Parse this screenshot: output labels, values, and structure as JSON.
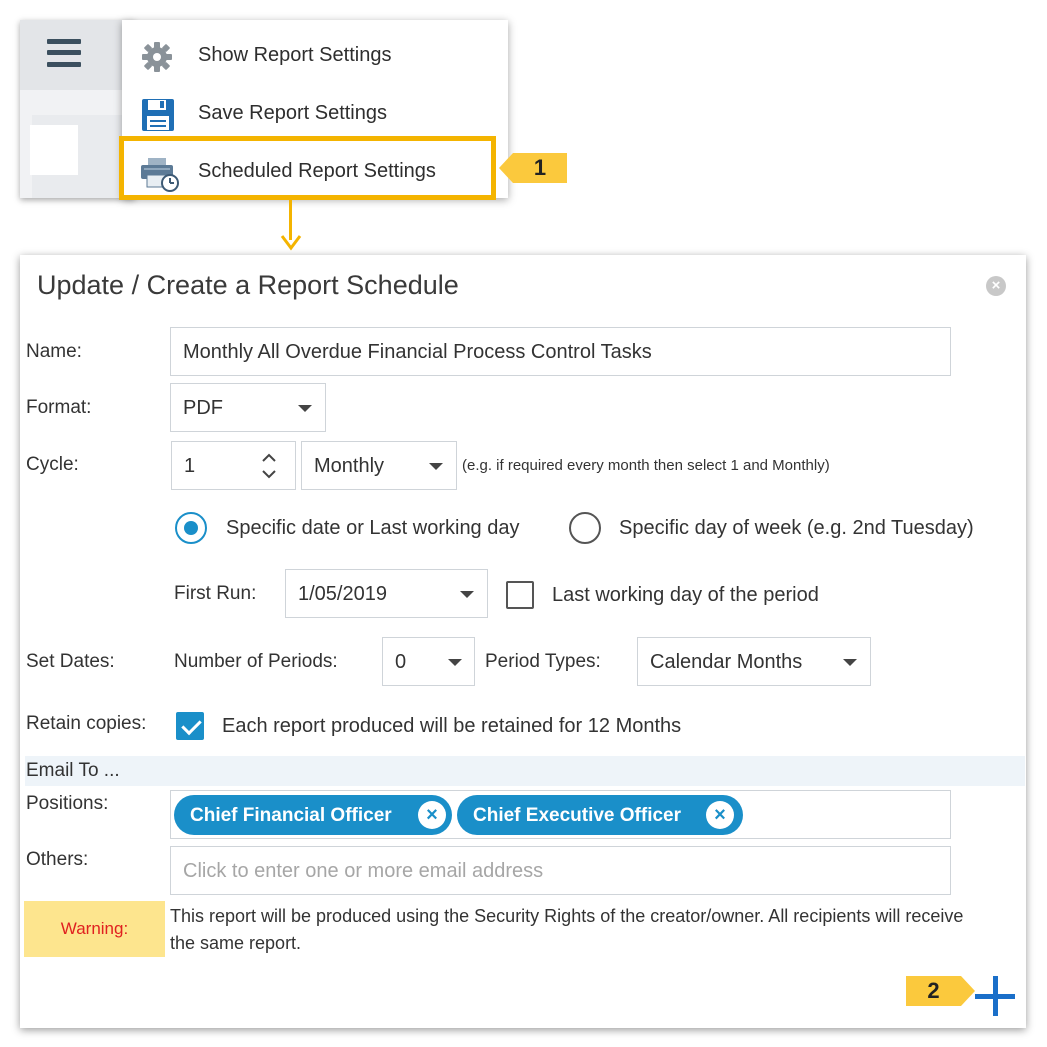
{
  "menu": {
    "items": [
      {
        "label": "Show Report Settings",
        "icon": "gear-icon"
      },
      {
        "label": "Save Report Settings",
        "icon": "floppy-disk-icon"
      },
      {
        "label": "Scheduled Report Settings",
        "icon": "printer-clock-icon"
      }
    ]
  },
  "callouts": {
    "step1": "1",
    "step2": "2"
  },
  "dialog": {
    "title": "Update / Create a Report Schedule",
    "close_icon": "close-icon",
    "name": {
      "label": "Name:",
      "value": "Monthly All Overdue Financial Process Control Tasks"
    },
    "format": {
      "label": "Format:",
      "value": "PDF"
    },
    "cycle": {
      "label": "Cycle:",
      "count": "1",
      "period": "Monthly",
      "hint": "(e.g. if required every month then select 1 and Monthly)"
    },
    "schedule_type": {
      "options": [
        "Specific date or Last working day",
        "Specific day of week (e.g. 2nd Tuesday)"
      ],
      "selected": 0
    },
    "first_run": {
      "label": "First Run:",
      "value": "1/05/2019",
      "last_working_day_label": "Last working day of the period",
      "last_working_day_checked": false
    },
    "set_dates": {
      "label": "Set Dates:",
      "periods_label": "Number of Periods:",
      "periods_value": "0",
      "period_types_label": "Period Types:",
      "period_types_value": "Calendar Months"
    },
    "retain": {
      "label": "Retain copies:",
      "checked": true,
      "text": "Each report produced will be retained for 12 Months"
    },
    "email_section": "Email To ...",
    "positions": {
      "label": "Positions:",
      "chips": [
        "Chief Financial Officer",
        "Chief Executive Officer"
      ]
    },
    "others": {
      "label": "Others:",
      "placeholder": "Click to enter one or more email address"
    },
    "warning": {
      "label": "Warning:",
      "text": "This report will be produced using the Security Rights of the creator/owner. All recipients will receive the same report."
    }
  },
  "colors": {
    "accent": "#1a8fc9",
    "highlight": "#f4b400",
    "callout": "#fbc93d",
    "warning_bg": "#fde58e",
    "warning_text": "#e02020"
  }
}
